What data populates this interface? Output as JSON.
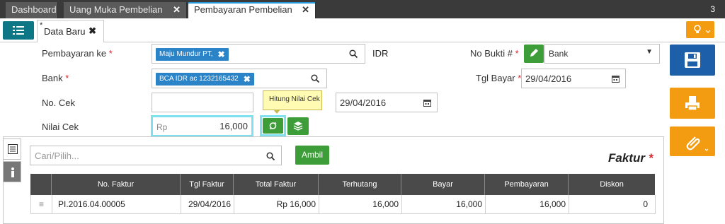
{
  "tabs": [
    {
      "label": "Dashboard"
    },
    {
      "label": "Uang Muka Pembelian"
    },
    {
      "label": "Pembayaran Pembelian"
    }
  ],
  "tab_count": "3",
  "doc_tab": {
    "label": "Data Baru",
    "modified_mark": "*"
  },
  "form": {
    "pembayaran_ke": {
      "label": "Pembayaran ke",
      "required": "*",
      "chip": "Maju Mundur PT,"
    },
    "currency": "IDR",
    "no_bukti": {
      "label": "No Bukti #",
      "required": "*",
      "select_value": "Bank"
    },
    "bank": {
      "label": "Bank",
      "required": "*",
      "chip": "BCA IDR ac 1232165432"
    },
    "tgl_bayar": {
      "label": "Tgl Bayar",
      "required": "*",
      "value": "29/04/2016"
    },
    "no_cek": {
      "label": "No. Cek",
      "value": "",
      "date": "29/04/2016"
    },
    "nilai_cek": {
      "label": "Nilai Cek",
      "prefix": "Rp",
      "value": "16,000"
    },
    "tooltip": "Hitung Nilai Cek"
  },
  "invoice": {
    "search_placeholder": "Cari/Pilih...",
    "take_label": "Ambil",
    "title": "Faktur",
    "required": "*",
    "columns": [
      "No. Faktur",
      "Tgl Faktur",
      "Total Faktur",
      "Terhutang",
      "Bayar",
      "Pembayaran",
      "Diskon"
    ],
    "rows": [
      {
        "no": "PI.2016.04.00005",
        "tgl": "29/04/2016",
        "total": "Rp 16,000",
        "terhutang": "16,000",
        "bayar": "16,000",
        "pembayaran": "16,000",
        "diskon": "0"
      }
    ]
  },
  "colors": {
    "accent": "#0e7785",
    "green": "#3d9d38",
    "orange": "#f39c12",
    "blue": "#1d5fa8",
    "chip": "#2b83c8"
  }
}
